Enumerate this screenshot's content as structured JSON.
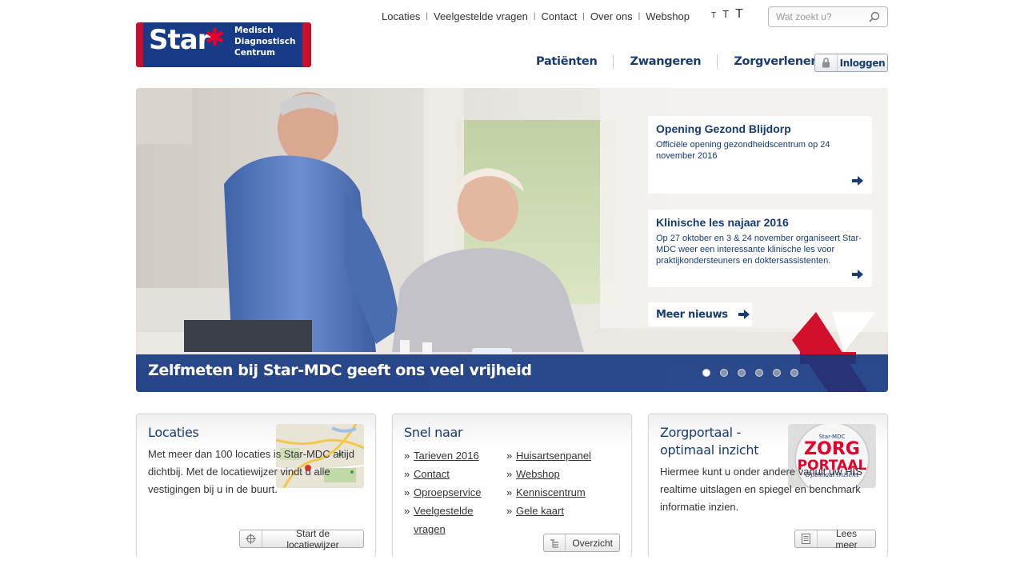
{
  "logo": {
    "brand": "Star",
    "subtitle_lines": [
      "Medisch",
      "Diagnostisch",
      "Centrum"
    ]
  },
  "top_links": [
    "Locaties",
    "Veelgestelde vragen",
    "Contact",
    "Over ons",
    "Webshop"
  ],
  "font_size_controls": [
    "T",
    "T",
    "T"
  ],
  "search": {
    "placeholder": "Wat zoekt u?",
    "icon": "search-icon"
  },
  "main_nav": [
    "Patiënten",
    "Zwangeren",
    "Zorgverleners"
  ],
  "login": {
    "label": "Inloggen",
    "icon": "lock-icon"
  },
  "hero": {
    "caption": "Zelfmeten bij Star-MDC geeft ons veel vrijheid",
    "slide_count": 6,
    "active_slide": 1,
    "news": [
      {
        "title": "Opening Gezond Blijdorp",
        "text": "Officiële opening gezondheidscentrum op 24 november 2016"
      },
      {
        "title": "Klinische les najaar 2016",
        "text": "Op 27 oktober en 3 & 24 november organiseert Star-MDC weer een interessante klinische les voor praktijkondersteuners en doktersassistenten."
      }
    ],
    "more_news": "Meer nieuws"
  },
  "boxes": {
    "locaties": {
      "title": "Locaties",
      "text": "Met meer dan 100 locaties is Star-MDC altijd dichtbij. Met de locatiewijzer vindt u alle vestigingen bij u in de buurt.",
      "button": "Start de locatiewijzer",
      "button_icon": "crosshair-icon"
    },
    "snel": {
      "title": "Snel naar",
      "links_col1": [
        "Tarieven 2016",
        "Contact",
        "Oproepservice",
        "Veelgestelde vragen"
      ],
      "links_col2": [
        "Huisartsenpanel",
        "Webshop",
        "Kenniscentrum",
        "Gele kaart"
      ],
      "button": "Overzicht",
      "button_icon": "list-icon"
    },
    "zorg": {
      "title": "Zorgportaal - optimaal inzicht",
      "text": "Hiermee kunt u onder andere vanuit uw HIS realtime uitslagen en spiegel en benchmark informatie inzien.",
      "button": "Lees meer",
      "button_icon": "document-icon",
      "badge_top": "Star-MDC",
      "badge_main": "ZORG",
      "badge_sub": "PORTAAL",
      "badge_tag": "Optimaal inzicht"
    }
  },
  "colors": {
    "navy": "#173b73",
    "brand_blue": "#173b87",
    "red": "#e4002b"
  }
}
